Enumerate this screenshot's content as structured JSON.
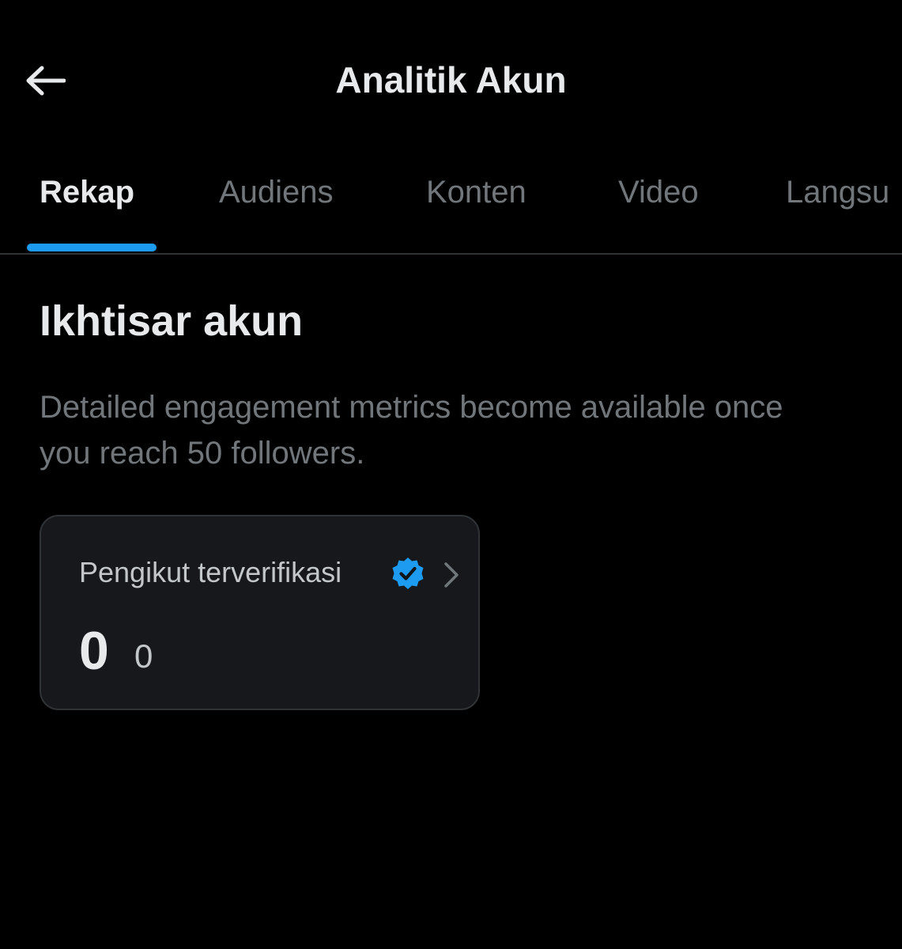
{
  "header": {
    "title": "Analitik Akun",
    "back_icon": "arrow-left-icon"
  },
  "tabs": [
    {
      "label": "Rekap",
      "active": true
    },
    {
      "label": "Audiens",
      "active": false
    },
    {
      "label": "Konten",
      "active": false
    },
    {
      "label": "Video",
      "active": false
    },
    {
      "label": "Langsu",
      "active": false
    }
  ],
  "overview": {
    "title": "Ikhtisar akun",
    "description": "Detailed engagement metrics become available once you reach 50 followers."
  },
  "verified_followers_card": {
    "label": "Pengikut terverifikasi",
    "value": "0",
    "change": "0",
    "icons": [
      "verified-badge-icon",
      "chevron-right-icon"
    ]
  },
  "colors": {
    "background": "#000000",
    "primary_text": "#e7e9ea",
    "secondary_text": "#71767b",
    "accent": "#1d9bf0",
    "card_background": "#16181c",
    "border": "#2f3336"
  }
}
